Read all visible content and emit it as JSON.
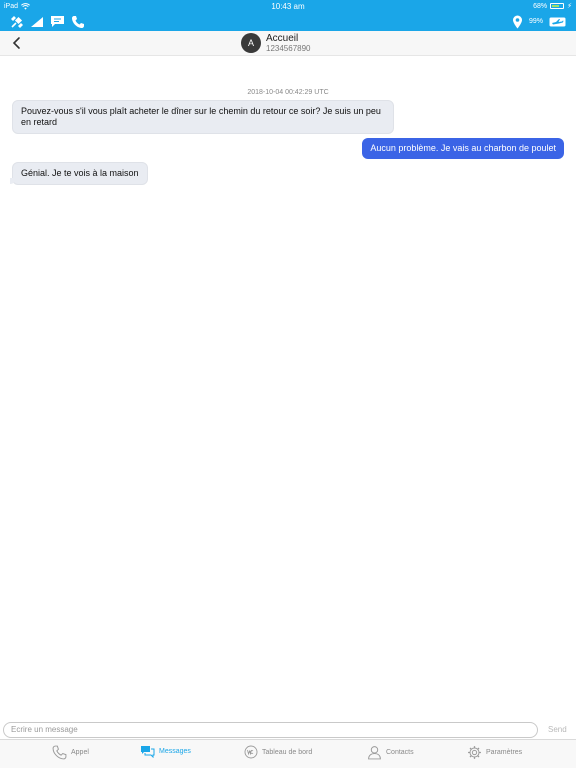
{
  "status_bar": {
    "device": "iPad",
    "time": "10:43 am",
    "battery": "68%",
    "battery_level": 0.68
  },
  "app_bar": {
    "quota": "99%"
  },
  "conversation": {
    "contact_initial": "A",
    "contact_name": "Accueil",
    "contact_number": "1234567890",
    "timestamp": "2018-10-04 00:42:29 UTC",
    "messages": [
      {
        "direction": "in",
        "text": "Pouvez-vous s'il vous plaît acheter le dîner sur le chemin du retour ce soir? Je suis un peu en retard"
      },
      {
        "direction": "out",
        "text": "Aucun problème. Je vais au charbon de poulet"
      },
      {
        "direction": "in",
        "text": "Génial. Je te vois à la maison"
      }
    ]
  },
  "composer": {
    "placeholder": "Ecrire un message",
    "send_label": "Send"
  },
  "tabs": [
    {
      "label": "Appel",
      "icon": "phone-icon",
      "active": false
    },
    {
      "label": "Messages",
      "icon": "chat-icon",
      "active": true
    },
    {
      "label": "Tableau de bord",
      "icon": "dashboard-icon",
      "active": false
    },
    {
      "label": "Contacts",
      "icon": "contacts-icon",
      "active": false
    },
    {
      "label": "Paramètres",
      "icon": "gear-icon",
      "active": false
    }
  ],
  "colors": {
    "brand": "#1aa6e8",
    "outgoing_bubble": "#3b64e6",
    "incoming_bubble": "#e9ecf2"
  }
}
